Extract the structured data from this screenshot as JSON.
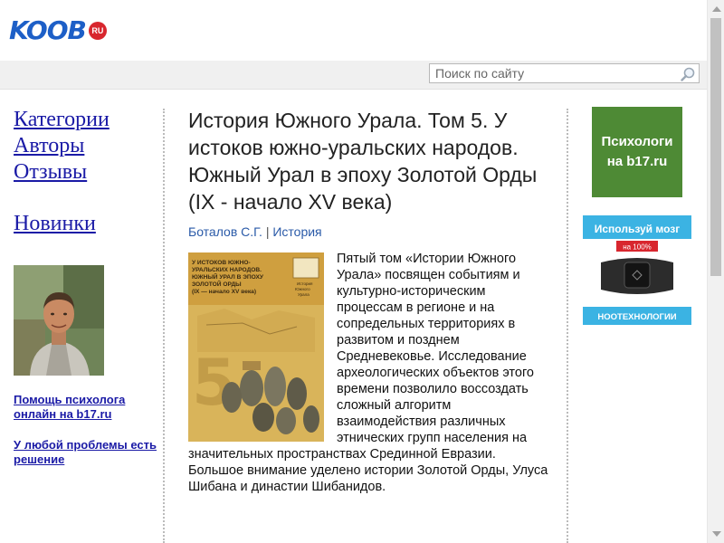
{
  "header": {
    "logo_text": "KOOB",
    "logo_badge": "RU",
    "brand_color": "#1d5fc7",
    "badge_color": "#d8262e"
  },
  "search": {
    "placeholder": "Поиск по сайту",
    "value": ""
  },
  "nav": {
    "categories": "Категории",
    "authors": "Авторы",
    "reviews": "Отзывы",
    "new": "Новинки"
  },
  "sidebar": {
    "help_link": "Помощь психолога онлайн на b17.ru",
    "problem_link": "У любой проблемы есть решение"
  },
  "book": {
    "title": "История Южного Урала. Том 5. У истоков южно-уральских народов. Южный Урал в эпоху Золотой Орды (IX - начало XV века)",
    "author": "Боталов С.Г.",
    "separator": "|",
    "category": "История",
    "description": "Пятый том «Истории Южного Урала» посвящен событиям и культурно-историческим процессам в регионе и на сопредельных территориях в развитом и позднем Средневековье. Исследование археологических объектов этого времени позволило воссоздать сложный алгоритм взаимодействия различных этнических групп населения на значительных пространствах Срединной Евразии. Большое внимание уделено истории Золотой Орды, Улуса Шибана и династии Шибанидов.",
    "cover": {
      "title": "У ИСТОКОВ ЮЖНО-УРАЛЬСКИХ НАРОДОВ. ЮЖНЫЙ УРАЛ В ЭПОХУ ЗОЛОТОЙ ОРДЫ (IX — начало XV века)",
      "series": "История Южного Урала",
      "volume": "5",
      "color": "#d9b45a"
    }
  },
  "ads": {
    "ad1_line1": "Психологи",
    "ad1_line2": "на b17.ru",
    "ad1_color": "#4e8a35",
    "ad2_headline": "Используй мозг",
    "ad2_badge": "на 100%",
    "ad2_brand": "НООТЕХНОЛОГИИ",
    "ad2_color": "#3bb3e3"
  }
}
